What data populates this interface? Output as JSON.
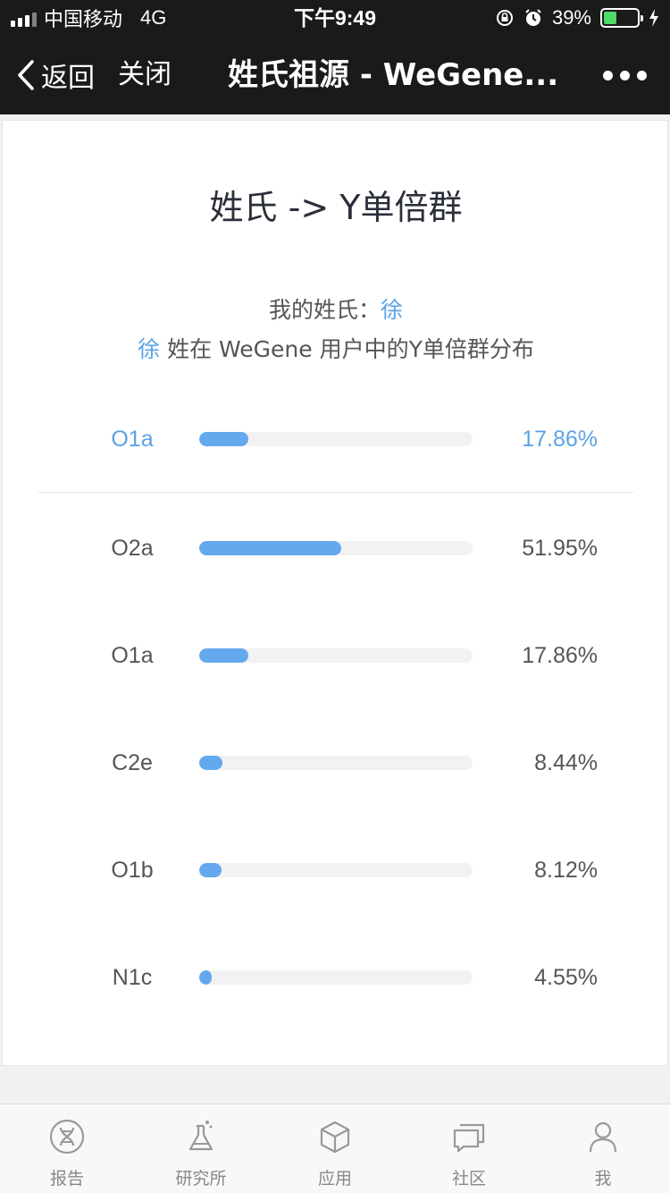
{
  "status_bar": {
    "carrier": "中国移动",
    "network": "4G",
    "time": "下午9:49",
    "battery_percent": "39%",
    "battery_level": 0.39,
    "battery_color": "#4cd964"
  },
  "nav": {
    "back_label": "返回",
    "close_label": "关闭",
    "title": "姓氏祖源 - WeGene...",
    "more_icon": "more-dots-icon"
  },
  "card": {
    "title": "姓氏 -> Y单倍群",
    "surname_prefix": "我的姓氏：",
    "surname": "徐",
    "desc_surname": "徐",
    "desc_text": " 姓在 WeGene 用户中的Y单倍群分布",
    "my_haplogroup": {
      "label": "O1a",
      "value": "17.86%",
      "fraction": 0.1786
    },
    "distribution": [
      {
        "label": "O2a",
        "value": "51.95%",
        "fraction": 0.5195
      },
      {
        "label": "O1a",
        "value": "17.86%",
        "fraction": 0.1786
      },
      {
        "label": "C2e",
        "value": "8.44%",
        "fraction": 0.0844
      },
      {
        "label": "O1b",
        "value": "8.12%",
        "fraction": 0.0812
      },
      {
        "label": "N1c",
        "value": "4.55%",
        "fraction": 0.0455
      }
    ]
  },
  "colors": {
    "accent": "#5ba3e6",
    "bar_fill": "#64a8ee",
    "bar_track": "#f2f2f4",
    "header_bg": "#1a1a1a"
  },
  "tabs": [
    {
      "label": "报告",
      "icon": "dna-icon"
    },
    {
      "label": "研究所",
      "icon": "flask-icon"
    },
    {
      "label": "应用",
      "icon": "cube-icon"
    },
    {
      "label": "社区",
      "icon": "chat-icon"
    },
    {
      "label": "我",
      "icon": "person-icon"
    }
  ]
}
